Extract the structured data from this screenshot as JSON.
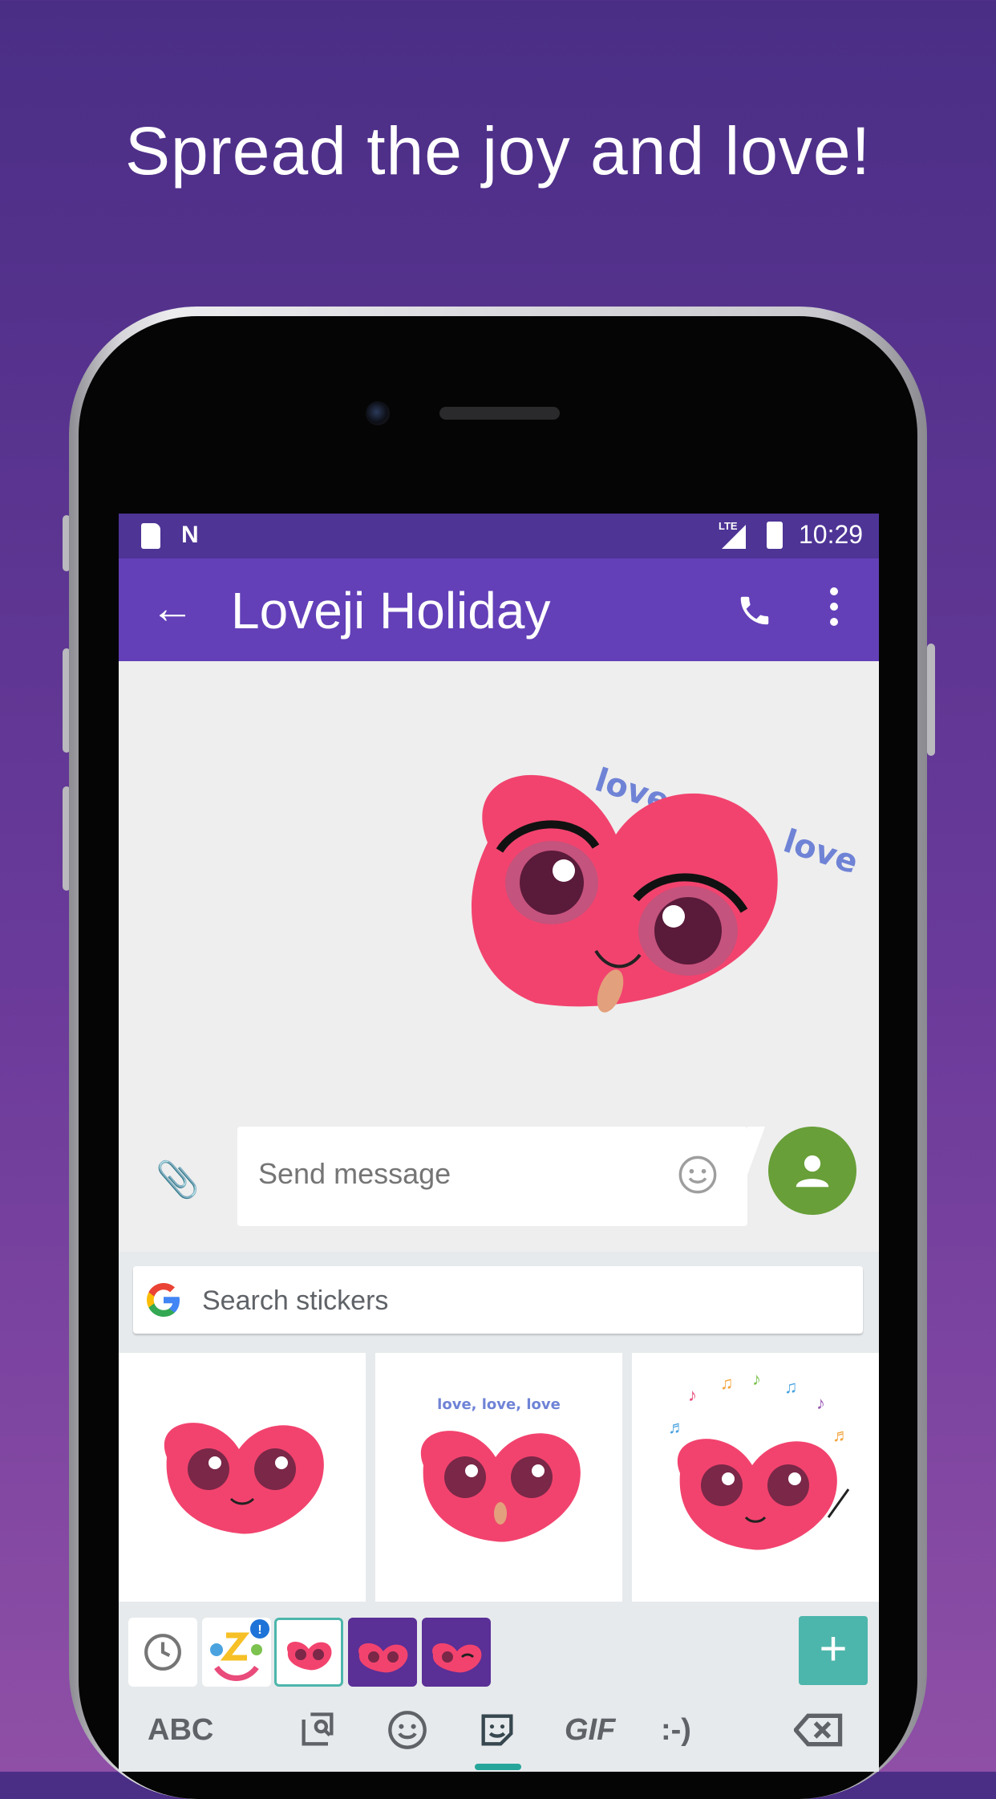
{
  "headline": "Spread the joy and love!",
  "status_bar": {
    "time": "10:29",
    "network": "LTE"
  },
  "app_bar": {
    "back_symbol": "←",
    "title": "Loveji Holiday"
  },
  "conversation": {
    "sticker_caption": "love, love, love"
  },
  "compose": {
    "placeholder": "Send message"
  },
  "keyboard": {
    "search_placeholder": "Search stickers",
    "grid_sticker_captions": [
      "",
      "love, love, love",
      ""
    ],
    "pack_badge": "!",
    "add_label": "+",
    "modes": {
      "abc": "ABC",
      "gif": "GIF",
      "emoticon": ":-)"
    }
  },
  "colors": {
    "background_top": "#4a2e86",
    "background_bottom": "#8f4fa6",
    "status_bar": "#4d3495",
    "app_bar": "#6340b8",
    "contact_button": "#689f38",
    "add_button": "#4db6ac",
    "active_tab": "#26a69a",
    "heart": "#f2436e"
  },
  "icons": [
    "back-arrow-icon",
    "phone-icon",
    "more-vert-icon",
    "sd-card-icon",
    "n-logo-icon",
    "signal-icon",
    "battery-icon",
    "attach-icon",
    "emoji-icon",
    "person-icon",
    "google-g-icon",
    "clock-icon",
    "keyboard-search-icon",
    "smiley-icon",
    "sticker-icon",
    "backspace-icon"
  ]
}
